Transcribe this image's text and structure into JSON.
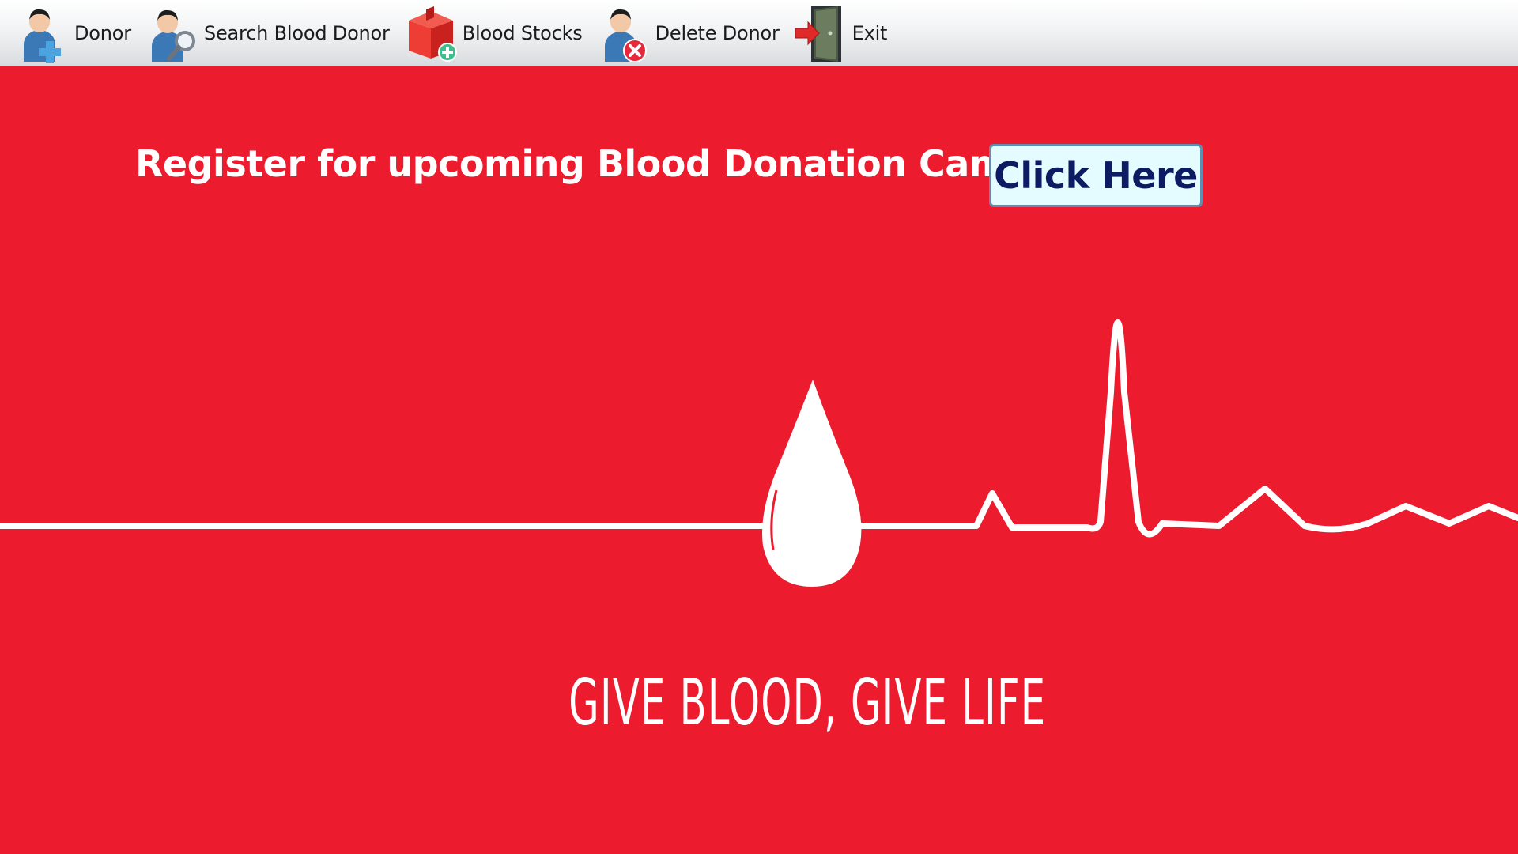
{
  "toolbar": {
    "items": [
      {
        "label": "Donor",
        "icon": "add-user-icon"
      },
      {
        "label": "Search Blood Donor",
        "icon": "search-user-icon"
      },
      {
        "label": "Blood Stocks",
        "icon": "add-stock-box-icon"
      },
      {
        "label": "Delete Donor",
        "icon": "delete-user-icon"
      },
      {
        "label": "Exit",
        "icon": "exit-door-icon"
      }
    ]
  },
  "banner": {
    "headline": "Register for upcoming Blood Donation Camp",
    "cta_label": "Click Here",
    "tagline": "GIVE BLOOD, GIVE LIFE"
  },
  "colors": {
    "background": "#ec1c2e",
    "cta_background": "#e4fbff",
    "cta_text": "#0d1c62",
    "cta_border": "#5d8fb2"
  }
}
